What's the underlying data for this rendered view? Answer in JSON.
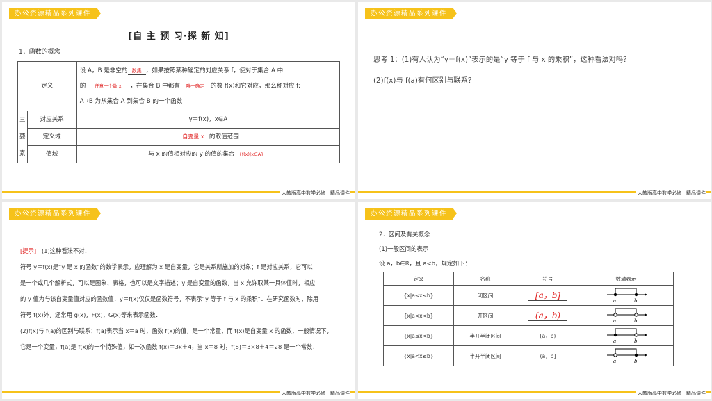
{
  "common": {
    "tag": "办公资源精品系列课件",
    "footer": "人教版高中数学必修一精品课件"
  },
  "slide1": {
    "title": "[自 主 预 习·探 新 知]",
    "section": "1．函数的概念",
    "def_label": "定义",
    "def_a": "设 A，B 是非空的",
    "def_blank1": "数集",
    "def_b": "，如果按照某种确定的对应关系 f，使对于集合 A 中",
    "def_c": "的",
    "def_blank2": "任意一个数 x",
    "def_d": "，在集合 B 中都有",
    "def_blank3": "唯一确定",
    "def_e": "的数 f(x)和它对应，那么称对应 f:",
    "def_f": "A→B 为从集合 A 到集合 B 的一个函数",
    "three_1": "三",
    "three_2": "要",
    "three_3": "素",
    "row1_label": "对应关系",
    "row1_value": "y＝f(x)，x∈A",
    "row2_label": "定义域",
    "row2_blank": "自变量 x",
    "row2_suffix": "的取值范围",
    "row3_label": "值域",
    "row3_prefix": "与 x 的值相对应的 y 的值的集合",
    "row3_blank": "{f(x)|x∈A}"
  },
  "slide2": {
    "line1": "思考 1：(1)有人认为“y＝f(x)”表示的是“y 等于 f 与 x 的乘积”，这种看法对吗？",
    "line2": "(2)f(x)与 f(a)有何区别与联系？"
  },
  "slide3": {
    "hint": "[提示]",
    "p1": "(1)这种看法不对．",
    "p2": "符号 y＝f(x)是“y 是 x 的函数”的数学表示，应理解为 x 是自变量，它是关系所施加的对象；f 是对应关系，它可以",
    "p3": "是一个或几个解析式，可以是图象、表格，也可以是文字描述；y 是自变量的函数，当 x 允许取某一具体值时，相应",
    "p4": "的 y 值为与该自变量值对应的函数值．y＝f(x)仅仅是函数符号，不表示“y 等于 f 与 x 的乘积”．在研究函数时，除用",
    "p5": "符号 f(x)外，还常用 g(x)，F(x)，G(x)等来表示函数．",
    "p6": "(2)f(x)与 f(a)的区别与联系：f(a)表示当 x＝a 时，函数 f(x)的值，是一个常量，而 f(x)是自变量 x 的函数，一般情况下，",
    "p7": "它是一个变量，f(a)是 f(x)的一个特殊值，如一次函数 f(x)＝3x＋4，当 x＝8 时，f(8)＝3×8＋4＝28 是一个常数．"
  },
  "slide4": {
    "section": "2．区间及有关概念",
    "sub": "(1)一般区间的表示",
    "premise": "设 a，b∈R，且 a<b，规定如下：",
    "headers": [
      "定义",
      "名称",
      "符号",
      "数轴表示"
    ],
    "rows": [
      {
        "def": "{x|a≤x≤b}",
        "name": "闭区间",
        "symbol": "[a，b]"
      },
      {
        "def": "{x|a<x<b}",
        "name": "开区间",
        "symbol": "(a，b)"
      },
      {
        "def": "{x|a≤x<b}",
        "name": "半开半闭区间",
        "symbol": "[a，b)"
      },
      {
        "def": "{x|a<x≤b}",
        "name": "半开半闭区间",
        "symbol": "(a，b]"
      }
    ],
    "axis_a": "a",
    "axis_b": "b"
  }
}
